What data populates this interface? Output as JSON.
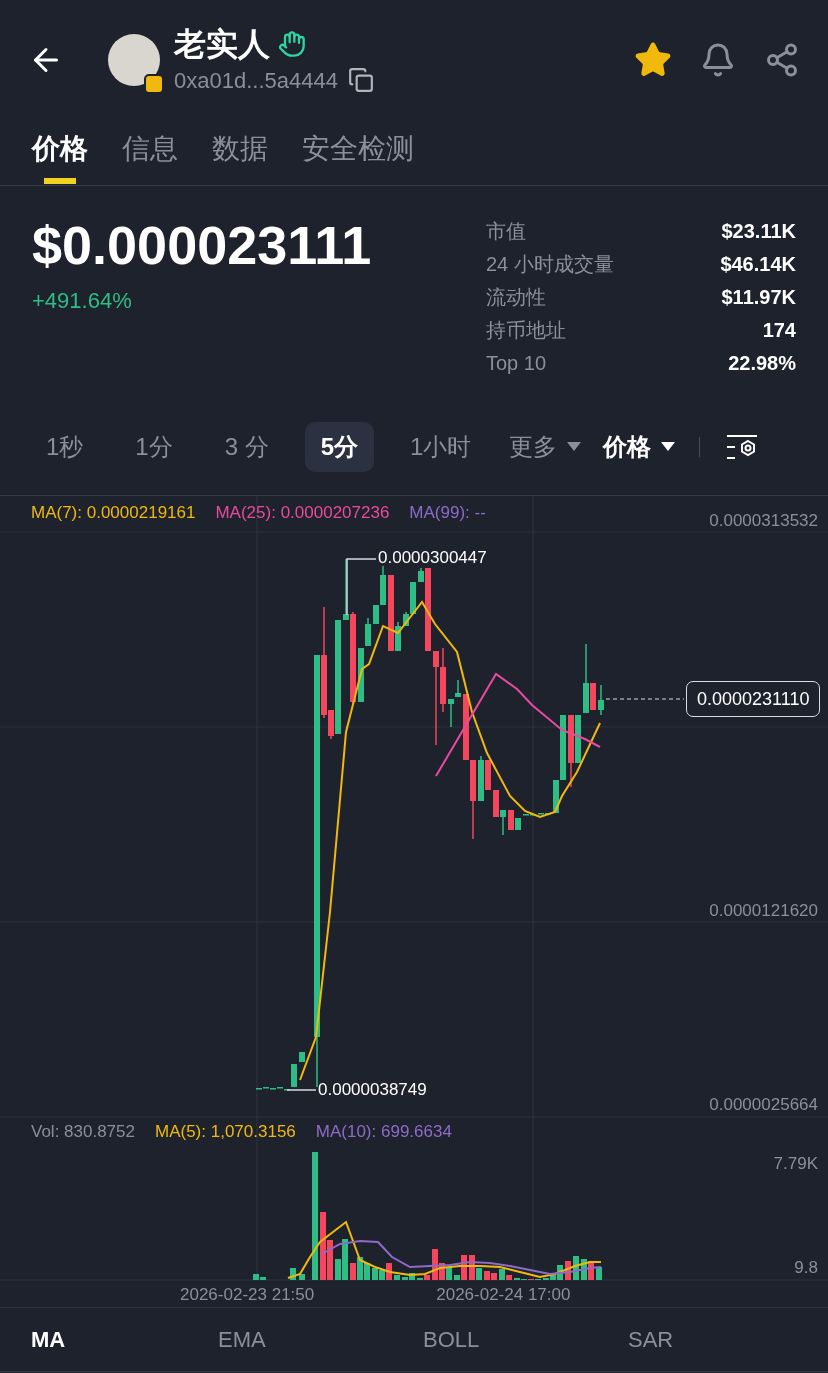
{
  "header": {
    "title": "老实人",
    "address": "0xa01d...5a4444",
    "favorite": true
  },
  "tabs": [
    {
      "label": "价格",
      "selected": true
    },
    {
      "label": "信息",
      "selected": false
    },
    {
      "label": "数据",
      "selected": false
    },
    {
      "label": "安全检测",
      "selected": false
    }
  ],
  "price": {
    "value": "$0.000023111",
    "change": "+491.64%"
  },
  "stats": [
    {
      "label": "市值",
      "value": "$23.11K"
    },
    {
      "label": "24 小时成交量",
      "value": "$46.14K"
    },
    {
      "label": "流动性",
      "value": "$11.97K"
    },
    {
      "label": "持币地址",
      "value": "174"
    },
    {
      "label": "Top 10",
      "value": "22.98%"
    }
  ],
  "intervals": [
    {
      "label": "1秒",
      "selected": false
    },
    {
      "label": "1分",
      "selected": false
    },
    {
      "label": "3 分",
      "selected": false
    },
    {
      "label": "5分",
      "selected": true
    },
    {
      "label": "1小时",
      "selected": false
    }
  ],
  "dropdowns": [
    {
      "label": "更多",
      "highlighted": false
    },
    {
      "label": "价格",
      "highlighted": true
    }
  ],
  "chart": {
    "legend": [
      "MA(7): 0.0000219161",
      "MA(25): 0.0000207236",
      "MA(99): --"
    ],
    "axis_labels": [
      "0.0000313532",
      "0.0000121620",
      "0.0000025664"
    ],
    "high_label": "0.0000300447",
    "low_label": "0.0000038749",
    "current_price": "0.0000231110"
  },
  "volume": {
    "legend": [
      "Vol: 830.8752",
      "MA(5): 1,070.3156",
      "MA(10): 699.6634"
    ],
    "axis_labels": [
      "7.79K",
      "9.8"
    ]
  },
  "dates": [
    "2026-02-23 21:50",
    "2026-02-24 17:00"
  ],
  "indicators": [
    {
      "label": "MA",
      "selected": true
    },
    {
      "label": "EMA",
      "selected": false
    },
    {
      "label": "BOLL",
      "selected": false
    },
    {
      "label": "SAR",
      "selected": false
    }
  ]
}
